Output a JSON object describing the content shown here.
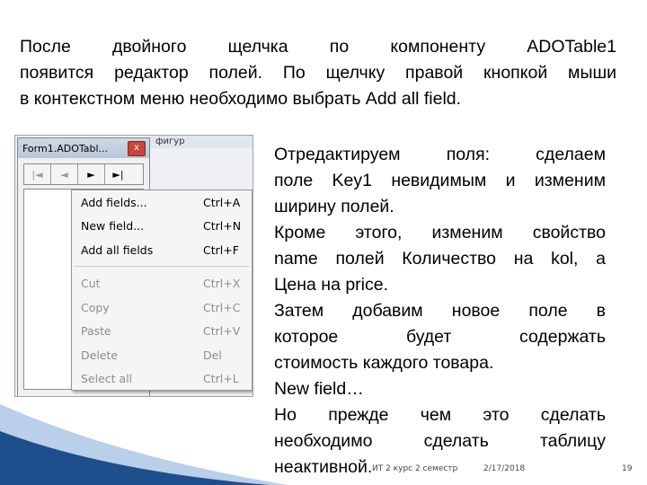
{
  "intro": {
    "lines": [
      "После двойного щелчка по компоненту ADOTable1",
      "появится редактор полей. По щелчку правой кнопкой мыши",
      "в контекстном меню необходимо выбрать Add all field."
    ]
  },
  "screenshot": {
    "bg_window_title": "фигур",
    "editor_title": "Form1.ADOTabl...",
    "close_label": "x",
    "nav_buttons": [
      "|◄",
      "◄",
      "►",
      "►|"
    ],
    "context_menu": [
      {
        "label": "Add fields...",
        "shortcut": "Ctrl+A",
        "enabled": true
      },
      {
        "label": "New field...",
        "shortcut": "Ctrl+N",
        "enabled": true
      },
      {
        "label": "Add all fields",
        "shortcut": "Ctrl+F",
        "enabled": true
      },
      {
        "label": "Cut",
        "shortcut": "Ctrl+X",
        "enabled": false
      },
      {
        "label": "Copy",
        "shortcut": "Ctrl+C",
        "enabled": false
      },
      {
        "label": "Paste",
        "shortcut": "Ctrl+V",
        "enabled": false
      },
      {
        "label": "Delete",
        "shortcut": "Del",
        "enabled": false
      },
      {
        "label": "Select all",
        "shortcut": "Ctrl+L",
        "enabled": true
      }
    ]
  },
  "right_text": {
    "lines": [
      "Отредактируем поля: сделаем",
      "поле Key1 невидимым и изменим",
      "ширину полей.",
      "Кроме этого, изменим свойство",
      "name полей Количество на kol, а",
      "Цена на price.",
      "Затем добавим новое поле в",
      "которое будет содержать",
      "стоимость каждого товара.",
      "New field…",
      "Но прежде чем это сделать",
      "необходимо сделать таблицу",
      "неактивной."
    ]
  },
  "footer": {
    "course": "ИТ 2 курс 2 семестр",
    "date": "2/17/2018",
    "page": "19"
  },
  "colors": {
    "deco_dark": "#1f4e8c",
    "deco_light": "#7fa8d8",
    "menu_bg": "#f5f5f5",
    "disabled_text": "#8c8c8c"
  }
}
